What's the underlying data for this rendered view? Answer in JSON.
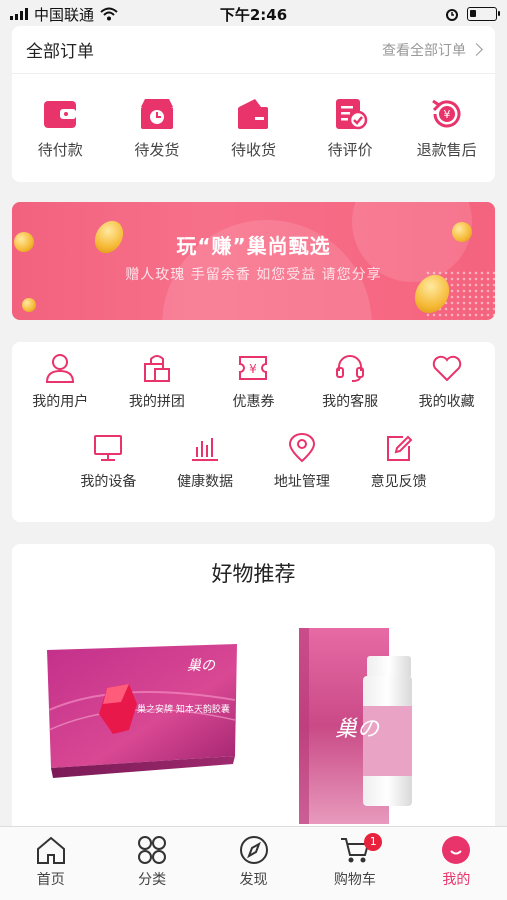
{
  "status_bar": {
    "carrier": "中国联通",
    "time": "下午2:46"
  },
  "orders": {
    "title": "全部订单",
    "view_all": "查看全部订单",
    "items": [
      {
        "label": "待付款",
        "icon": "wallet-icon"
      },
      {
        "label": "待发货",
        "icon": "clock-box-icon"
      },
      {
        "label": "待收货",
        "icon": "package-icon"
      },
      {
        "label": "待评价",
        "icon": "review-icon"
      },
      {
        "label": "退款售后",
        "icon": "refund-icon"
      }
    ]
  },
  "banner": {
    "title": "玩“赚”巢尚甄选",
    "subtitle": "赠人玫瑰 手留余香 如您受益 请您分享"
  },
  "services": {
    "items": [
      {
        "label": "我的用户",
        "icon": "user-icon"
      },
      {
        "label": "我的拼团",
        "icon": "group-buy-icon"
      },
      {
        "label": "优惠券",
        "icon": "coupon-icon"
      },
      {
        "label": "我的客服",
        "icon": "headset-icon"
      },
      {
        "label": "我的收藏",
        "icon": "heart-icon"
      },
      {
        "label": "我的设备",
        "icon": "monitor-icon"
      },
      {
        "label": "健康数据",
        "icon": "bar-chart-icon"
      },
      {
        "label": "地址管理",
        "icon": "location-icon"
      },
      {
        "label": "意见反馈",
        "icon": "edit-icon"
      }
    ]
  },
  "recommend": {
    "title": "好物推荐",
    "products": [
      {
        "box_text": "巢之安牌 知本天韵胶囊",
        "brand_mark": "巢の"
      },
      {
        "brand_mark": "巢の"
      }
    ]
  },
  "tabbar": {
    "items": [
      {
        "label": "首页",
        "icon": "home-icon"
      },
      {
        "label": "分类",
        "icon": "category-icon"
      },
      {
        "label": "发现",
        "icon": "compass-icon"
      },
      {
        "label": "购物车",
        "icon": "cart-icon",
        "badge": "1"
      },
      {
        "label": "我的",
        "icon": "profile-icon",
        "active": true
      }
    ]
  },
  "colors": {
    "accent": "#e8336b",
    "banner": "#f5637e",
    "badge": "#e8213c"
  }
}
